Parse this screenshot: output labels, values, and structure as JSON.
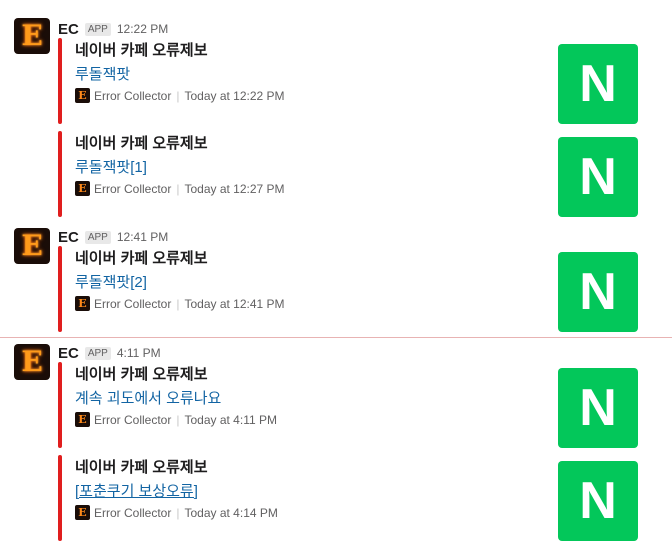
{
  "groups": [
    {
      "sender": "EC",
      "badge": "APP",
      "time": "12:22 PM",
      "avatar_letter": "E",
      "attachments": [
        {
          "title": "네이버 카페 오류제보",
          "text": "루돌잭팟",
          "footer_name": "Error Collector",
          "footer_time": "Today at 12:22 PM",
          "thumb_letter": "N"
        },
        {
          "title": "네이버 카페 오류제보",
          "text": "루돌잭팟[1]",
          "footer_name": "Error Collector",
          "footer_time": "Today at 12:27 PM",
          "thumb_letter": "N"
        }
      ]
    },
    {
      "sender": "EC",
      "badge": "APP",
      "time": "12:41 PM",
      "avatar_letter": "E",
      "attachments": [
        {
          "title": "네이버 카페 오류제보",
          "text": "루돌잭팟[2]",
          "footer_name": "Error Collector",
          "footer_time": "Today at 12:41 PM",
          "thumb_letter": "N"
        }
      ]
    },
    {
      "sender": "EC",
      "badge": "APP",
      "time": "4:11 PM",
      "avatar_letter": "E",
      "attachments": [
        {
          "title": "네이버 카페 오류제보",
          "text": "계속 괴도에서 오류나요",
          "footer_name": "Error Collector",
          "footer_time": "Today at 4:11 PM",
          "thumb_letter": "N"
        },
        {
          "title": "네이버 카페 오류제보",
          "text": "[포춘쿠기 보상오류]",
          "footer_name": "Error Collector",
          "footer_time": "Today at 4:14 PM",
          "thumb_letter": "N"
        }
      ]
    }
  ],
  "colors": {
    "accent_bar": "#e01e1e",
    "link": "#1264a3",
    "naver_green": "#03c75a",
    "new_divider": "#e8b3b3"
  },
  "icons": {
    "avatar": "ec-app-avatar-icon",
    "thumb": "naver-logo-icon"
  }
}
